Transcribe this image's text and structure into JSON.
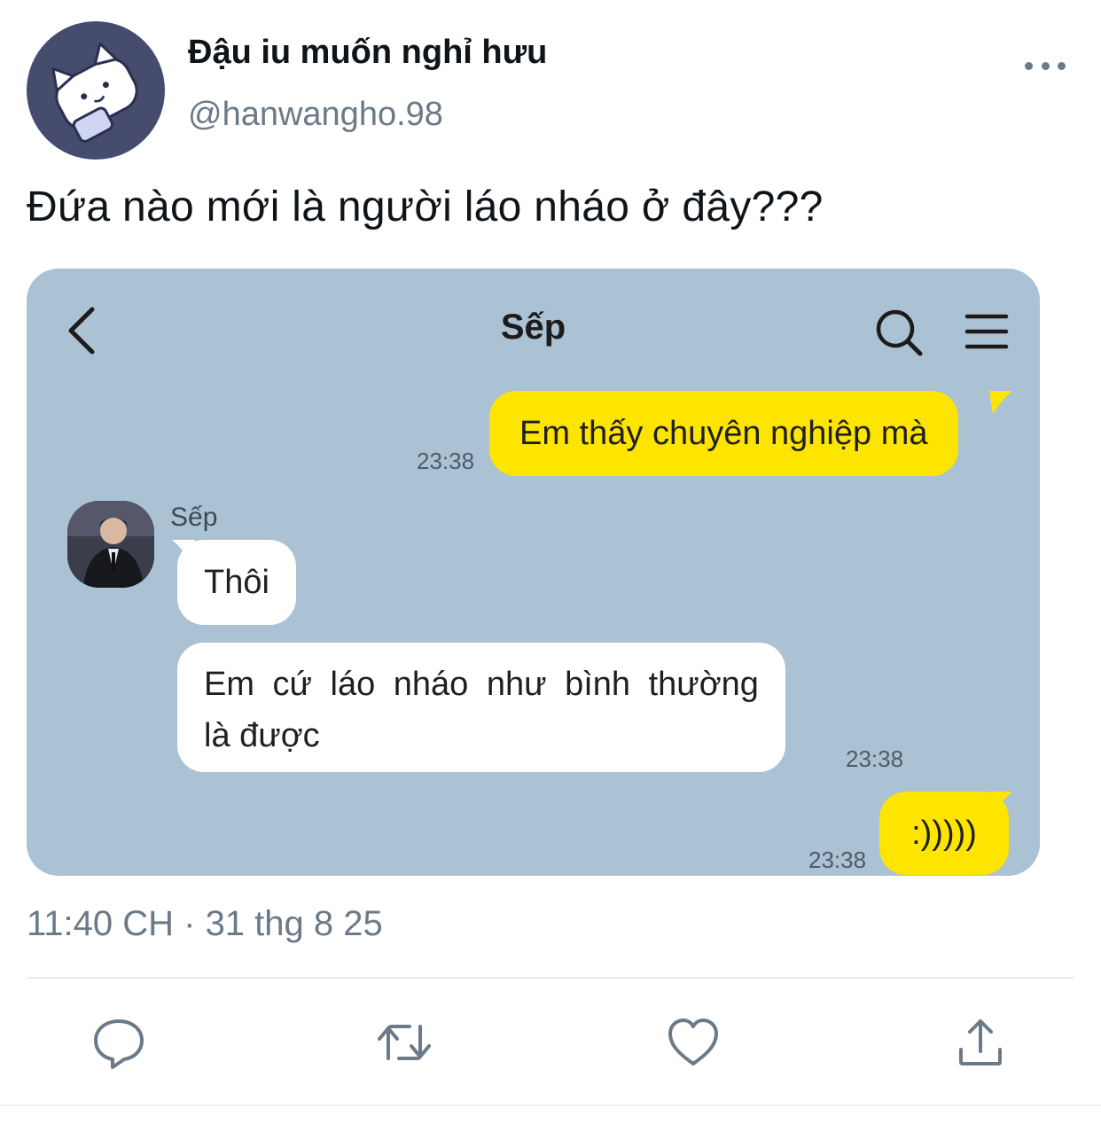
{
  "tweet": {
    "display_name": "Đậu iu muốn nghỉ hưu",
    "handle": "@hanwangho.98",
    "text": "Đứa nào mới là người láo nháo ở đây???",
    "timestamp": "11:40 CH · 31 thg 8 25"
  },
  "chat": {
    "title": "Sếp",
    "messages": [
      {
        "side": "right",
        "text": "Em thấy chuyên nghiệp mà",
        "time": "23:38"
      },
      {
        "side": "left",
        "sender": "Sếp",
        "text": "Thôi"
      },
      {
        "side": "left",
        "text_line1_words": [
          "Em",
          "cứ",
          "láo",
          "nháo",
          "như",
          "bình",
          "thường"
        ],
        "text_line2": "là được",
        "time": "23:38"
      },
      {
        "side": "right",
        "text": ":)))))",
        "time": "23:38"
      }
    ]
  },
  "icons": {
    "more": "more-icon",
    "back": "chevron-left-icon",
    "search": "search-icon",
    "menu": "menu-icon",
    "reply": "reply-icon",
    "retweet": "retweet-icon",
    "like": "heart-icon",
    "share": "share-icon"
  },
  "colors": {
    "chat_background": "#abc1d4",
    "my_bubble": "#fee500",
    "their_bubble": "#ffffff",
    "secondary_text": "#6b7a88"
  }
}
